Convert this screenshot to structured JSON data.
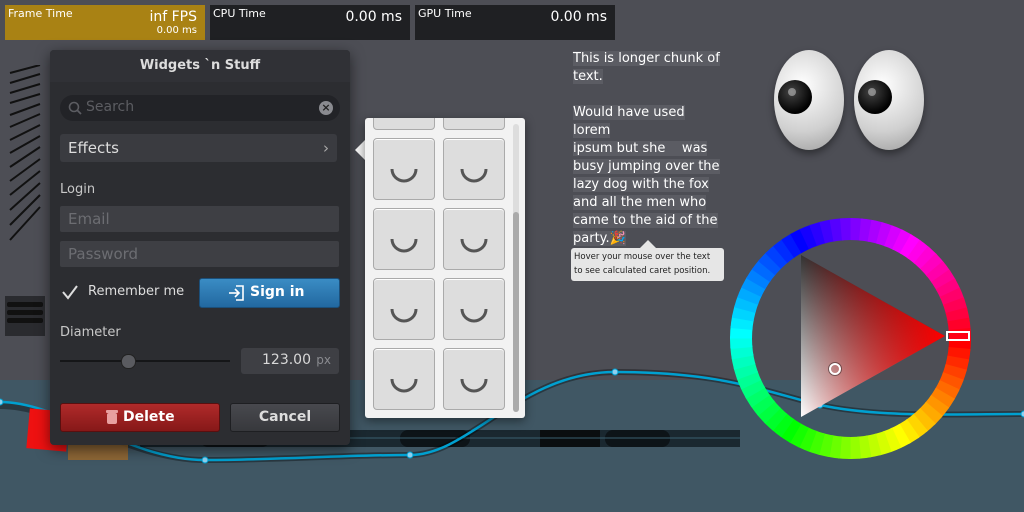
{
  "perf": {
    "frame": {
      "label": "Frame Time",
      "value": "inf FPS",
      "sub": "0.00 ms"
    },
    "cpu": {
      "label": "CPU Time",
      "value": "0.00 ms"
    },
    "gpu": {
      "label": "GPU Time",
      "value": "0.00 ms"
    }
  },
  "window": {
    "title": "Widgets `n Stuff",
    "search_placeholder": "Search",
    "effects_label": "Effects",
    "login_label": "Login",
    "email_placeholder": "Email",
    "password_placeholder": "Password",
    "remember_label": "Remember me",
    "remember_checked": true,
    "signin_label": "Sign in",
    "diameter_label": "Diameter",
    "diameter_value": "123.00",
    "diameter_unit": "px",
    "slider_fraction": 0.4,
    "delete_label": "Delete",
    "cancel_label": "Cancel"
  },
  "paragraph": {
    "lines": [
      "This is longer chunk of",
      "text.",
      "",
      "Would have used lorem",
      "ipsum but she    was",
      "busy jumping over the",
      "lazy dog with the fox",
      "and all the men who",
      "came to the aid of the",
      "party.🎉"
    ],
    "tooltip": "Hover your mouse over the text to see calculated caret position."
  },
  "colors": {
    "frame_accent": "#a98214",
    "signin": "#2a78b0",
    "delete": "#a52222",
    "graph_line": "#00a0d0"
  },
  "icons": [
    "search-icon",
    "clear-icon",
    "chevron-right-icon",
    "checkmark-icon",
    "login-icon",
    "trash-icon",
    "spinner-icon"
  ]
}
